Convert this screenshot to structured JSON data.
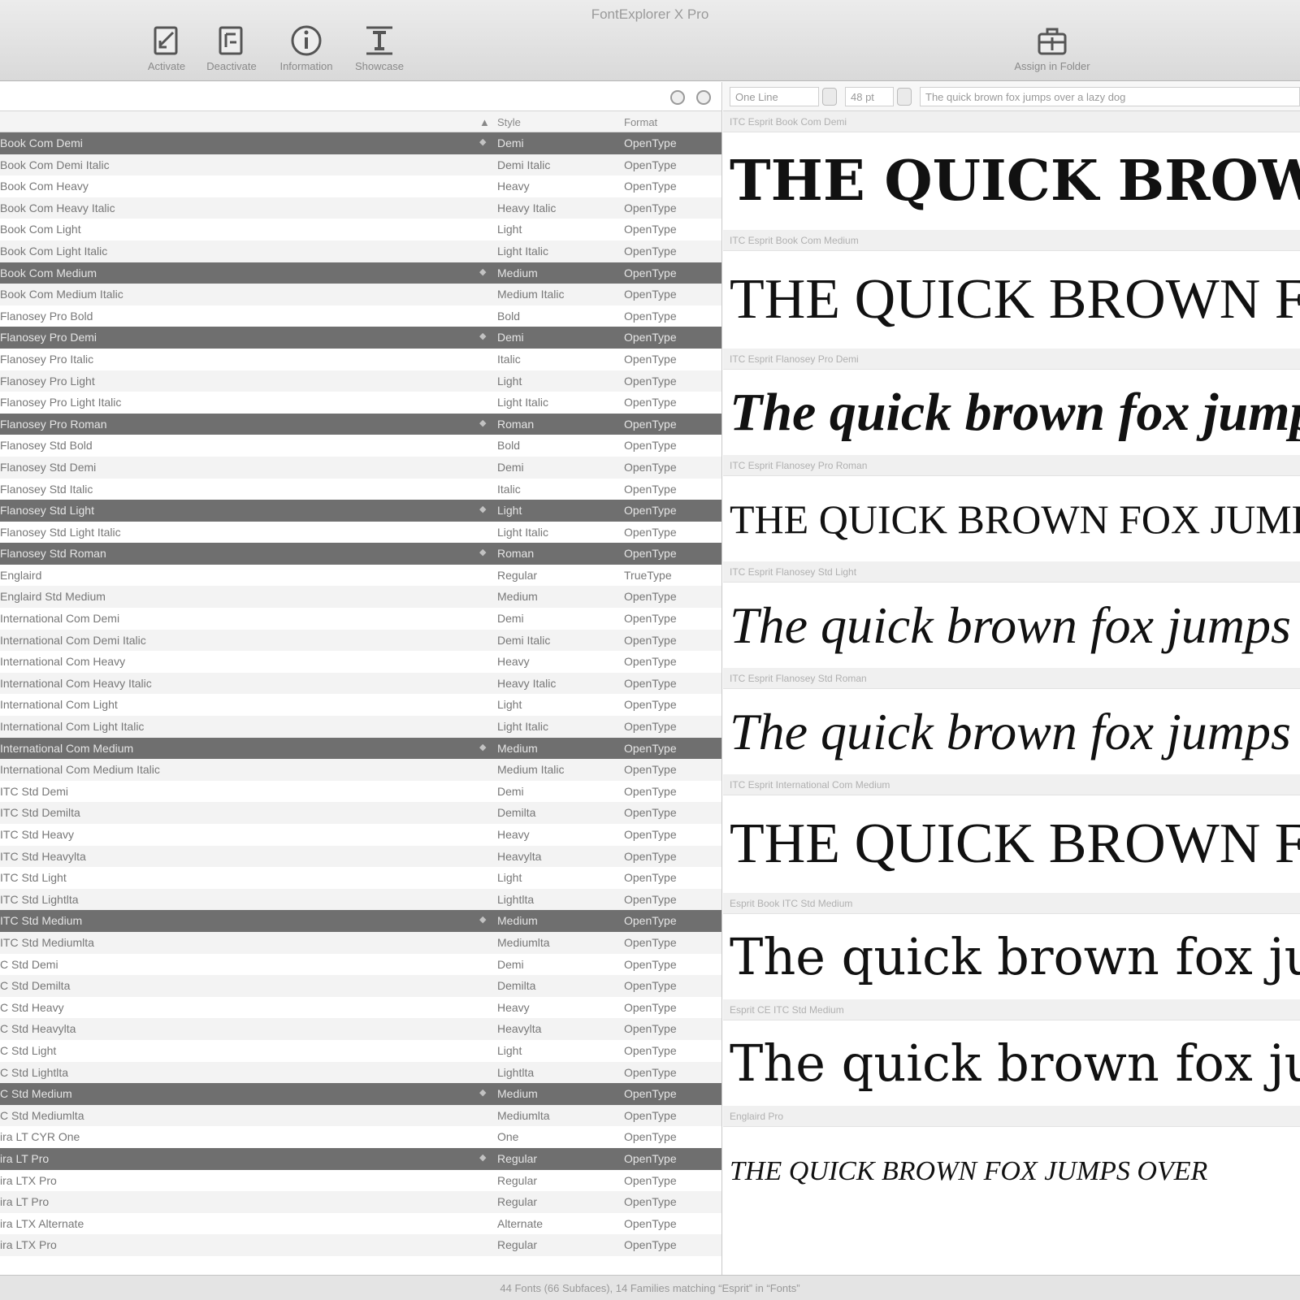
{
  "window": {
    "title": "FontExplorer X Pro"
  },
  "toolbar": {
    "activate": "Activate",
    "deactivate": "Deactivate",
    "information": "Information",
    "showcase": "Showcase",
    "assign": "Assign in Folder"
  },
  "list": {
    "headers": {
      "style": "Style",
      "format": "Format"
    },
    "rows": [
      {
        "name": "Book Com Demi",
        "style": "Demi",
        "format": "OpenType",
        "selected": true
      },
      {
        "name": "Book Com Demi Italic",
        "style": "Demi Italic",
        "format": "OpenType",
        "selected": false
      },
      {
        "name": "Book Com Heavy",
        "style": "Heavy",
        "format": "OpenType",
        "selected": false
      },
      {
        "name": "Book Com Heavy Italic",
        "style": "Heavy Italic",
        "format": "OpenType",
        "selected": false
      },
      {
        "name": "Book Com Light",
        "style": "Light",
        "format": "OpenType",
        "selected": false
      },
      {
        "name": "Book Com Light Italic",
        "style": "Light Italic",
        "format": "OpenType",
        "selected": false
      },
      {
        "name": "Book Com Medium",
        "style": "Medium",
        "format": "OpenType",
        "selected": true
      },
      {
        "name": "Book Com Medium Italic",
        "style": "Medium Italic",
        "format": "OpenType",
        "selected": false
      },
      {
        "name": "Flanosey Pro Bold",
        "style": "Bold",
        "format": "OpenType",
        "selected": false
      },
      {
        "name": "Flanosey Pro Demi",
        "style": "Demi",
        "format": "OpenType",
        "selected": true
      },
      {
        "name": "Flanosey Pro Italic",
        "style": "Italic",
        "format": "OpenType",
        "selected": false
      },
      {
        "name": "Flanosey Pro Light",
        "style": "Light",
        "format": "OpenType",
        "selected": false
      },
      {
        "name": "Flanosey Pro Light Italic",
        "style": "Light Italic",
        "format": "OpenType",
        "selected": false
      },
      {
        "name": "Flanosey Pro Roman",
        "style": "Roman",
        "format": "OpenType",
        "selected": true
      },
      {
        "name": "Flanosey Std Bold",
        "style": "Bold",
        "format": "OpenType",
        "selected": false
      },
      {
        "name": "Flanosey Std Demi",
        "style": "Demi",
        "format": "OpenType",
        "selected": false
      },
      {
        "name": "Flanosey Std Italic",
        "style": "Italic",
        "format": "OpenType",
        "selected": false
      },
      {
        "name": "Flanosey Std Light",
        "style": "Light",
        "format": "OpenType",
        "selected": true
      },
      {
        "name": "Flanosey Std Light Italic",
        "style": "Light Italic",
        "format": "OpenType",
        "selected": false
      },
      {
        "name": "Flanosey Std Roman",
        "style": "Roman",
        "format": "OpenType",
        "selected": true
      },
      {
        "name": "Englaird",
        "style": "Regular",
        "format": "TrueType",
        "selected": false
      },
      {
        "name": "Englaird Std Medium",
        "style": "Medium",
        "format": "OpenType",
        "selected": false
      },
      {
        "name": "International Com Demi",
        "style": "Demi",
        "format": "OpenType",
        "selected": false
      },
      {
        "name": "International Com Demi Italic",
        "style": "Demi Italic",
        "format": "OpenType",
        "selected": false
      },
      {
        "name": "International Com Heavy",
        "style": "Heavy",
        "format": "OpenType",
        "selected": false
      },
      {
        "name": "International Com Heavy Italic",
        "style": "Heavy Italic",
        "format": "OpenType",
        "selected": false
      },
      {
        "name": "International Com Light",
        "style": "Light",
        "format": "OpenType",
        "selected": false
      },
      {
        "name": "International Com Light Italic",
        "style": "Light Italic",
        "format": "OpenType",
        "selected": false
      },
      {
        "name": "International Com Medium",
        "style": "Medium",
        "format": "OpenType",
        "selected": true
      },
      {
        "name": "International Com Medium Italic",
        "style": "Medium Italic",
        "format": "OpenType",
        "selected": false
      },
      {
        "name": "ITC Std Demi",
        "style": "Demi",
        "format": "OpenType",
        "selected": false
      },
      {
        "name": "ITC Std Demilta",
        "style": "Demilta",
        "format": "OpenType",
        "selected": false
      },
      {
        "name": "ITC Std Heavy",
        "style": "Heavy",
        "format": "OpenType",
        "selected": false
      },
      {
        "name": "ITC Std Heavylta",
        "style": "Heavylta",
        "format": "OpenType",
        "selected": false
      },
      {
        "name": "ITC Std Light",
        "style": "Light",
        "format": "OpenType",
        "selected": false
      },
      {
        "name": "ITC Std Lightlta",
        "style": "Lightlta",
        "format": "OpenType",
        "selected": false
      },
      {
        "name": "ITC Std Medium",
        "style": "Medium",
        "format": "OpenType",
        "selected": true
      },
      {
        "name": "ITC Std Mediumlta",
        "style": "Mediumlta",
        "format": "OpenType",
        "selected": false
      },
      {
        "name": "C Std Demi",
        "style": "Demi",
        "format": "OpenType",
        "selected": false
      },
      {
        "name": "C Std Demilta",
        "style": "Demilta",
        "format": "OpenType",
        "selected": false
      },
      {
        "name": "C Std Heavy",
        "style": "Heavy",
        "format": "OpenType",
        "selected": false
      },
      {
        "name": "C Std Heavylta",
        "style": "Heavylta",
        "format": "OpenType",
        "selected": false
      },
      {
        "name": "C Std Light",
        "style": "Light",
        "format": "OpenType",
        "selected": false
      },
      {
        "name": "C Std Lightlta",
        "style": "Lightlta",
        "format": "OpenType",
        "selected": false
      },
      {
        "name": "C Std Medium",
        "style": "Medium",
        "format": "OpenType",
        "selected": true
      },
      {
        "name": "C Std Mediumlta",
        "style": "Mediumlta",
        "format": "OpenType",
        "selected": false
      },
      {
        "name": "ira LT CYR One",
        "style": "One",
        "format": "OpenType",
        "selected": false
      },
      {
        "name": "ira LT Pro",
        "style": "Regular",
        "format": "OpenType",
        "selected": true
      },
      {
        "name": "ira LTX Pro",
        "style": "Regular",
        "format": "OpenType",
        "selected": false
      },
      {
        "name": "ira LT Pro",
        "style": "Regular",
        "format": "OpenType",
        "selected": false
      },
      {
        "name": "ira LTX Alternate",
        "style": "Alternate",
        "format": "OpenType",
        "selected": false
      },
      {
        "name": "ira LTX Pro",
        "style": "Regular",
        "format": "OpenType",
        "selected": false
      }
    ]
  },
  "preview": {
    "mode": "One Line",
    "size": "48 pt",
    "sample_text": "The quick brown fox jumps over a lazy dog",
    "items": [
      {
        "label": "ITC Esprit Book Com Demi",
        "sample": "THE QUICK BROWN FOX JUMPS",
        "style": "caps-bold"
      },
      {
        "label": "ITC Esprit Book Com Medium",
        "sample": "THE QUICK BROWN FOX JUMPS",
        "style": "caps"
      },
      {
        "label": "ITC Esprit Flanosey Pro Demi",
        "sample": "The quick brown fox jumps over",
        "style": "script-bold"
      },
      {
        "label": "ITC Esprit Flanosey Pro Roman",
        "sample": "THE QUICK BROWN FOX JUMPS",
        "style": "smallcaps"
      },
      {
        "label": "ITC Esprit Flanosey Std Light",
        "sample": "The quick brown fox jumps over",
        "style": "script-light"
      },
      {
        "label": "ITC Esprit Flanosey Std Roman",
        "sample": "The quick brown fox jumps over",
        "style": "script"
      },
      {
        "label": "ITC Esprit International Com Medium",
        "sample": "THE QUICK BROWN FOX JUMPS",
        "style": "caps"
      },
      {
        "label": "Esprit Book ITC Std Medium",
        "sample": "The quick brown fox jumps",
        "style": "wide"
      },
      {
        "label": "Esprit CE ITC Std Medium",
        "sample": "The quick brown fox jumps",
        "style": "wide"
      },
      {
        "label": "Englaird Pro",
        "sample": "THE QUICK BROWN FOX JUMPS OVER",
        "style": "italic-caps"
      }
    ]
  },
  "status": {
    "text": "44 Fonts (66 Subfaces), 14 Families matching “Esprit” in “Fonts”"
  }
}
